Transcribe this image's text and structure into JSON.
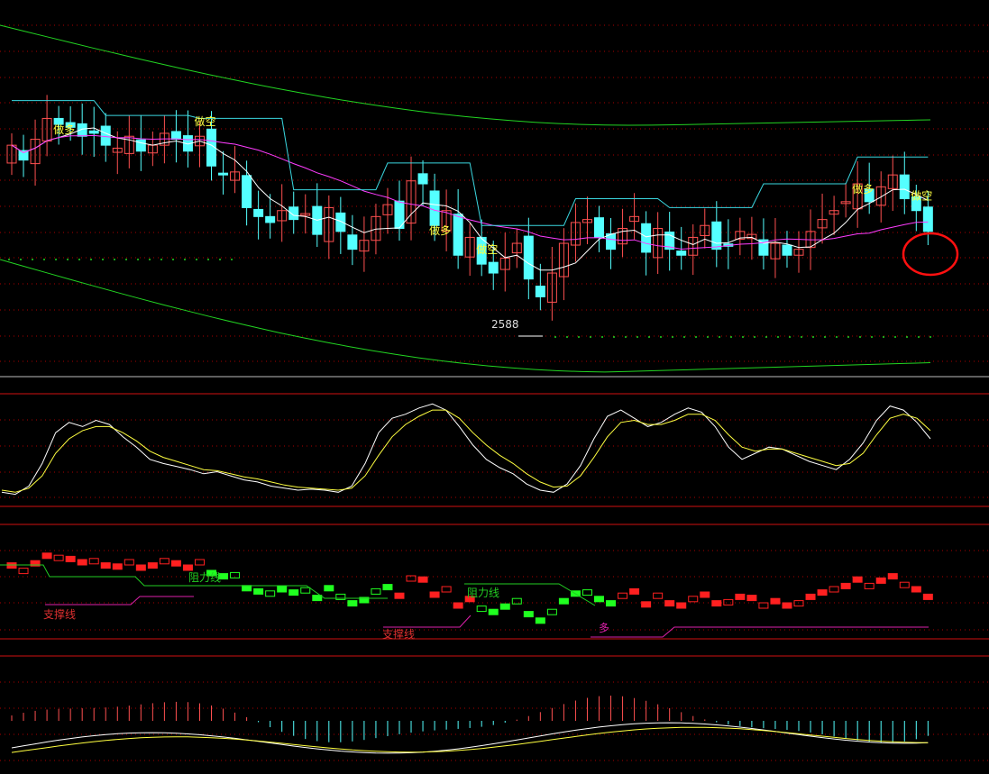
{
  "colors": {
    "background": "#000000",
    "up_candle": "#ff5050",
    "down_candle": "#54ffff",
    "ma_white": "#ffffff",
    "ma_magenta": "#ff3cff",
    "band_green": "#22d422",
    "band_red": "#e02020",
    "label_yellow": "#ffff40",
    "grid_red": "#aa0000",
    "k_line": "#ffffff",
    "d_line": "#ffff40",
    "sub_up": "#ff2020",
    "sub_down": "#20ff20",
    "support_line": "#dd20aa",
    "resistance_line": "#22cc22",
    "highlight_circle": "#ff1010"
  },
  "annotations": {
    "low_price": "2588",
    "buy_label": "做多",
    "sell_label": "做空",
    "support_label": "支撑线",
    "resistance_label": "阻力线",
    "long_label": "多"
  },
  "chart_data": [
    {
      "type": "candlestick",
      "panel": "price",
      "title": "",
      "grid": true,
      "overlays": [
        "moving-average-white",
        "moving-average-magenta",
        "channel-upper",
        "channel-lower",
        "step-line-cyan"
      ],
      "notable_low": 2588,
      "signals": [
        {
          "label": "做多",
          "bar": 4
        },
        {
          "label": "做空",
          "bar": 16
        },
        {
          "label": "做多",
          "bar": 36
        },
        {
          "label": "做空",
          "bar": 40
        },
        {
          "label": "做多",
          "bar": 72
        },
        {
          "label": "做空",
          "bar": 77
        }
      ],
      "highlight_bar": 78
    },
    {
      "type": "line",
      "panel": "oscillator",
      "title": "",
      "series": [
        {
          "values": [
            12,
            10,
            18,
            40,
            70,
            80,
            76,
            82,
            78,
            66,
            56,
            44,
            40,
            37,
            34,
            30,
            32,
            28,
            24,
            22,
            18,
            16,
            14,
            15,
            14,
            12,
            18,
            40,
            70,
            84,
            88,
            94,
            98,
            92,
            76,
            58,
            44,
            36,
            30,
            20,
            14,
            12,
            20,
            38,
            64,
            86,
            92,
            84,
            76,
            80,
            88,
            94,
            90,
            76,
            56,
            44,
            50,
            56,
            54,
            48,
            42,
            38,
            34,
            44,
            60,
            82,
            96,
            92,
            80,
            64
          ]
        },
        {
          "values": [
            14,
            12,
            16,
            28,
            50,
            64,
            72,
            76,
            76,
            70,
            62,
            52,
            46,
            42,
            38,
            34,
            33,
            30,
            27,
            25,
            22,
            19,
            17,
            16,
            15,
            14,
            16,
            28,
            48,
            66,
            78,
            86,
            92,
            92,
            84,
            70,
            58,
            48,
            40,
            30,
            22,
            17,
            18,
            28,
            46,
            66,
            80,
            82,
            78,
            78,
            82,
            88,
            88,
            82,
            68,
            56,
            52,
            54,
            54,
            50,
            46,
            42,
            38,
            40,
            50,
            68,
            84,
            88,
            84,
            72
          ]
        }
      ]
    },
    {
      "type": "bar",
      "panel": "momentum",
      "title": ""
    }
  ]
}
